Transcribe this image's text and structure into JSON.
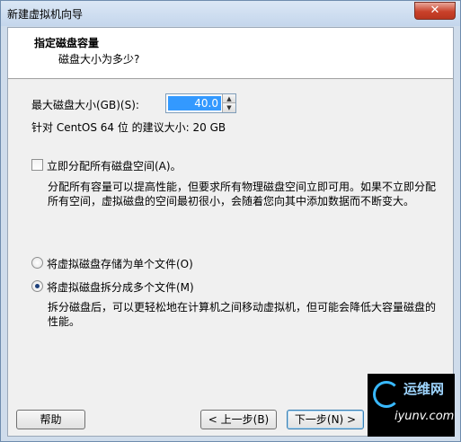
{
  "window": {
    "title": "新建虚拟机向导",
    "close_icon": "close-icon"
  },
  "header": {
    "title": "指定磁盘容量",
    "subtitle": "磁盘大小为多少?"
  },
  "disk": {
    "max_size_label": "最大磁盘大小(GB)(S):",
    "max_size_value": "40.0",
    "recommend_text": "针对 CentOS 64 位 的建议大小: 20 GB"
  },
  "allocate": {
    "checkbox_label": "立即分配所有磁盘空间(A)。",
    "checked": false,
    "description": "分配所有容量可以提高性能，但要求所有物理磁盘空间立即可用。如果不立即分配所有空间，虚拟磁盘的空间最初很小，会随着您向其中添加数据而不断变大。"
  },
  "storage_options": [
    {
      "label": "将虚拟磁盘存储为单个文件(O)",
      "checked": false
    },
    {
      "label": "将虚拟磁盘拆分成多个文件(M)",
      "checked": true
    }
  ],
  "split_description": "拆分磁盘后，可以更轻松地在计算机之间移动虚拟机，但可能会降低大容量磁盘的性能。",
  "buttons": {
    "help": "帮助",
    "back": "< 上一步(B)",
    "next": "下一步(N) >"
  },
  "watermark": {
    "line1": "运维网",
    "line2": "iyunv.com"
  },
  "colors": {
    "selection": "#3399ff",
    "titlebar": "#cfdceb"
  }
}
